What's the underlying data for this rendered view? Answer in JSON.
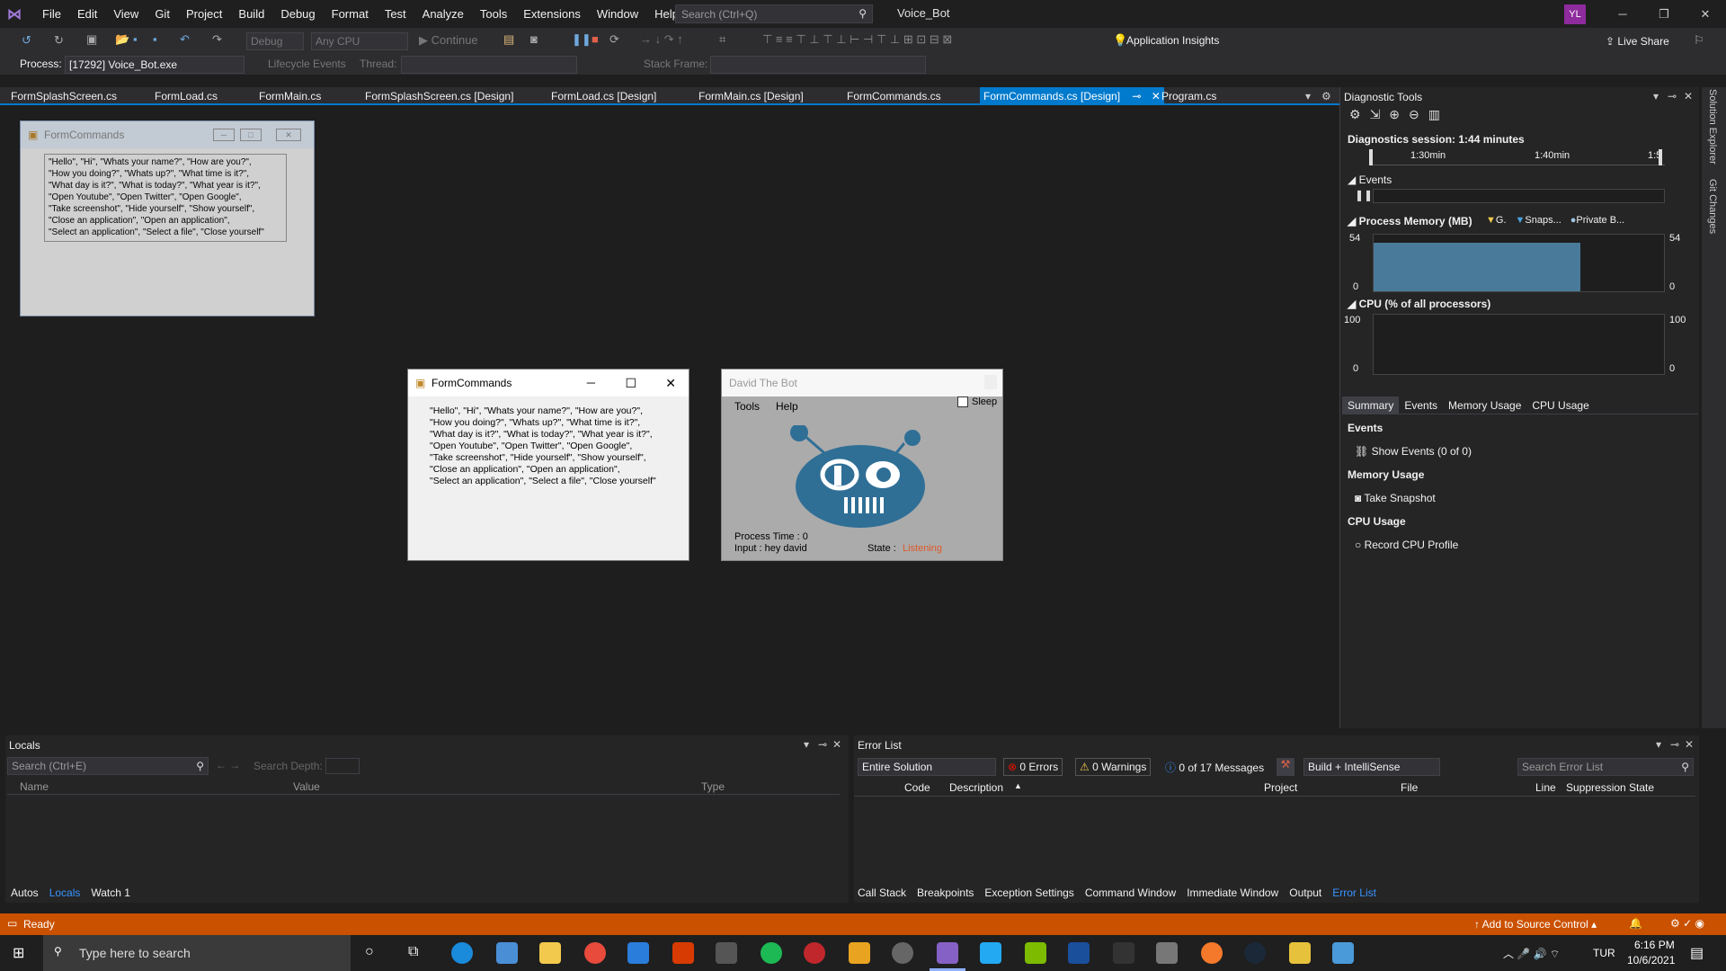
{
  "menubar": {
    "items": [
      "File",
      "Edit",
      "View",
      "Git",
      "Project",
      "Build",
      "Debug",
      "Format",
      "Test",
      "Analyze",
      "Tools",
      "Extensions",
      "Window",
      "Help"
    ],
    "search_placeholder": "Search (Ctrl+Q)",
    "solution_name": "Voice_Bot",
    "user_initials": "YL"
  },
  "toolbar": {
    "config": "Debug",
    "platform": "Any CPU",
    "continue_label": "Continue",
    "app_insights": "Application Insights",
    "live_share": "Live Share"
  },
  "toolbar2": {
    "process_label": "Process:",
    "process_value": "[17292] Voice_Bot.exe",
    "lifecycle": "Lifecycle Events",
    "thread_label": "Thread:",
    "stack_label": "Stack Frame:"
  },
  "tabs": [
    "FormSplashScreen.cs",
    "FormLoad.cs",
    "FormMain.cs",
    "FormSplashScreen.cs [Design]",
    "FormLoad.cs [Design]",
    "FormMain.cs [Design]",
    "FormCommands.cs",
    "FormCommands.cs [Design]",
    "Program.cs"
  ],
  "designer_form": {
    "title": "FormCommands",
    "text": "\"Hello\", \"Hi\", \"Whats your name?\", \"How are you?\",\n\"How you doing?\", \"Whats up?\", \"What time is it?\",\n\"What day is it?\", \"What is today?\", \"What year is it?\",\n\"Open Youtube\", \"Open Twitter\", \"Open Google\",\n\"Take screenshot\", \"Hide yourself\", \"Show yourself\",\n\"Close an application\", \"Open an application\",\n\"Select an application\", \"Select a file\", \"Close yourself\""
  },
  "running_form": {
    "title": "FormCommands"
  },
  "bot_window": {
    "title": "David The Bot",
    "menu_tools": "Tools",
    "menu_help": "Help",
    "sleep_label": "Sleep",
    "process_time": "Process Time :  0",
    "input": "Input :   hey david",
    "state_label": "State :",
    "state_value": "Listening"
  },
  "diagnostics": {
    "title": "Diagnostic Tools",
    "session": "Diagnostics session: 1:44 minutes",
    "timeline": [
      "1:30min",
      "1:40min",
      "1:5"
    ],
    "events_label": "Events",
    "memory_label": "Process Memory (MB)",
    "memory_legend": [
      "G.",
      "Snaps...",
      "Private B..."
    ],
    "memory_max": "54",
    "memory_min": "0",
    "memory_fill_fraction": 0.85,
    "cpu_label": "CPU (% of all processors)",
    "cpu_max": "100",
    "cpu_min": "0",
    "tabs": [
      "Summary",
      "Events",
      "Memory Usage",
      "CPU Usage"
    ],
    "summary_events": "Events",
    "show_events": "Show Events (0 of 0)",
    "summary_memory": "Memory Usage",
    "take_snapshot": "Take Snapshot",
    "summary_cpu": "CPU Usage",
    "record_cpu": "Record CPU Profile",
    "side_tabs": [
      "Solution Explorer",
      "Git Changes"
    ]
  },
  "locals": {
    "title": "Locals",
    "search_placeholder": "Search (Ctrl+E)",
    "search_depth": "Search Depth:",
    "columns": [
      "Name",
      "Value",
      "Type"
    ],
    "tabs": [
      "Autos",
      "Locals",
      "Watch 1"
    ]
  },
  "errorlist": {
    "title": "Error List",
    "scope": "Entire Solution",
    "errors": "0 Errors",
    "warnings": "0 Warnings",
    "messages": "0 of 17 Messages",
    "build": "Build + IntelliSense",
    "search_placeholder": "Search Error List",
    "columns": [
      "Code",
      "Description",
      "Project",
      "File",
      "Line",
      "Suppression State"
    ],
    "tabs": [
      "Call Stack",
      "Breakpoints",
      "Exception Settings",
      "Command Window",
      "Immediate Window",
      "Output",
      "Error List"
    ]
  },
  "statusbar": {
    "ready": "Ready",
    "source_control": "Add to Source Control"
  },
  "taskbar": {
    "search_placeholder": "Type here to search",
    "lang": "TUR",
    "time": "6:16 PM",
    "date": "10/6/2021"
  },
  "colors": {
    "accent": "#007acc",
    "status": "#ca5100",
    "bot_blue": "#2f6f96",
    "listening": "#e05a2a"
  }
}
